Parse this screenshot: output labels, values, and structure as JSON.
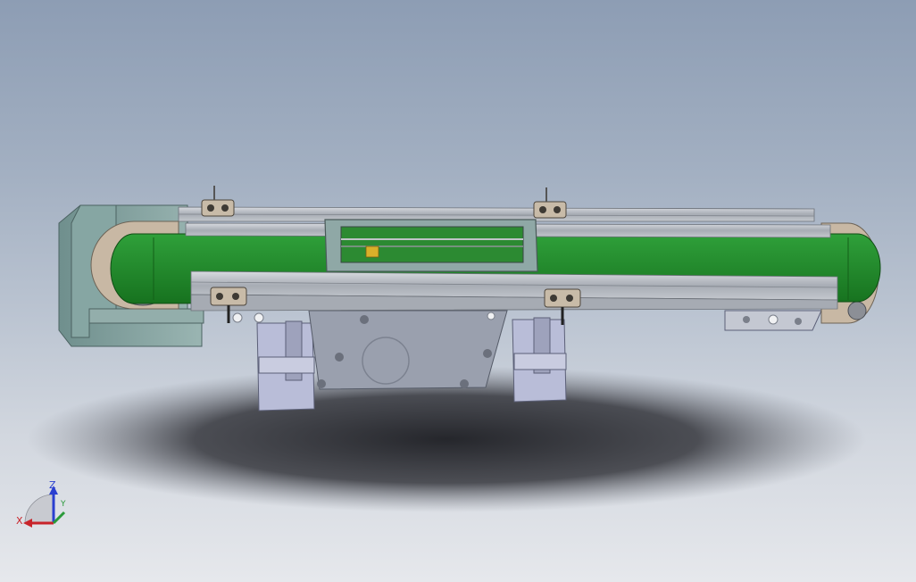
{
  "window": {
    "title": ""
  },
  "triad": {
    "x_label": "X",
    "y_label": "Y",
    "z_label": "Z"
  },
  "colors": {
    "background_top": "#8d9db4",
    "background_bottom": "#e6e8ec",
    "belt_green": "#1f8a2a",
    "aluminum_frame": "#b7bcc4",
    "cover_teal": "#7d9c9a",
    "axis_x": "#c8242a",
    "axis_y": "#2a9a3a",
    "axis_z": "#2a3fd0"
  }
}
